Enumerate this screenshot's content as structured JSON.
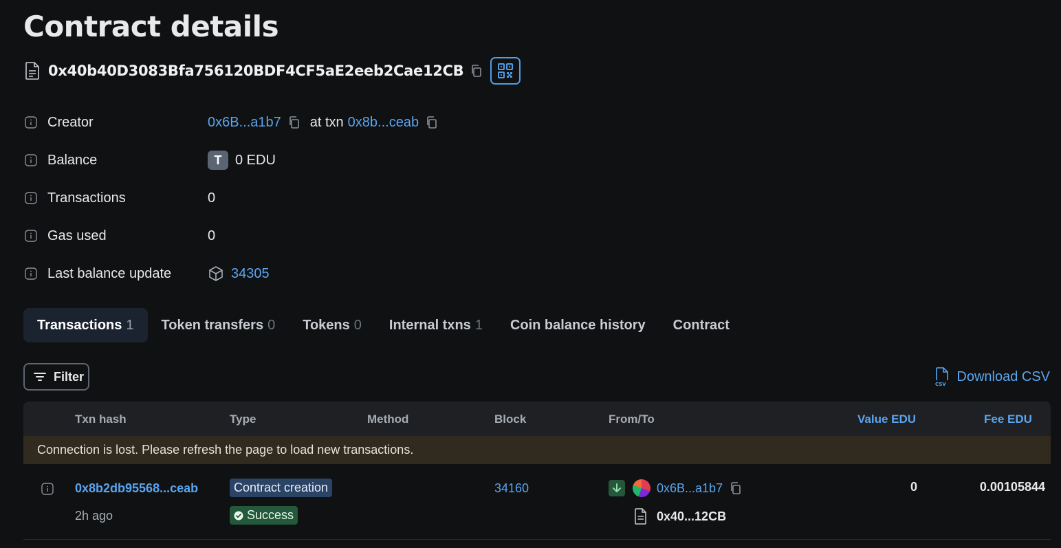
{
  "page": {
    "title": "Contract details"
  },
  "contract": {
    "address": "0x40b40D3083Bfa756120BDF4CF5aE2eeb2Cae12CB"
  },
  "details": {
    "creator": {
      "label": "Creator",
      "address": "0x6B...a1b7",
      "at_txn_text": "at txn",
      "txn": "0x8b...ceab"
    },
    "balance": {
      "label": "Balance",
      "token_letter": "T",
      "value": "0 EDU"
    },
    "transactions": {
      "label": "Transactions",
      "value": "0"
    },
    "gas_used": {
      "label": "Gas used",
      "value": "0"
    },
    "last_balance_update": {
      "label": "Last balance update",
      "block": "34305"
    }
  },
  "tabs": [
    {
      "label": "Transactions",
      "count": "1",
      "active": true
    },
    {
      "label": "Token transfers",
      "count": "0"
    },
    {
      "label": "Tokens",
      "count": "0"
    },
    {
      "label": "Internal txns",
      "count": "1"
    },
    {
      "label": "Coin balance history",
      "count": ""
    },
    {
      "label": "Contract",
      "count": ""
    }
  ],
  "toolbar": {
    "filter_label": "Filter",
    "download_label": "Download CSV"
  },
  "table": {
    "headers": {
      "txn_hash": "Txn hash",
      "type": "Type",
      "method": "Method",
      "block": "Block",
      "from_to": "From/To",
      "value": "Value EDU",
      "fee": "Fee EDU"
    },
    "notice": "Connection is lost. Please refresh the page to load new transactions.",
    "rows": [
      {
        "hash": "0x8b2db95568...ceab",
        "age": "2h ago",
        "type": "Contract creation",
        "status": "Success",
        "block": "34160",
        "from": "0x6B...a1b7",
        "to": "0x40...12CB",
        "value": "0",
        "fee": "0.00105844"
      }
    ]
  },
  "colors": {
    "background": "#101112",
    "link": "#5aa5f0",
    "success": "#23583a",
    "tag": "#2b4466"
  }
}
